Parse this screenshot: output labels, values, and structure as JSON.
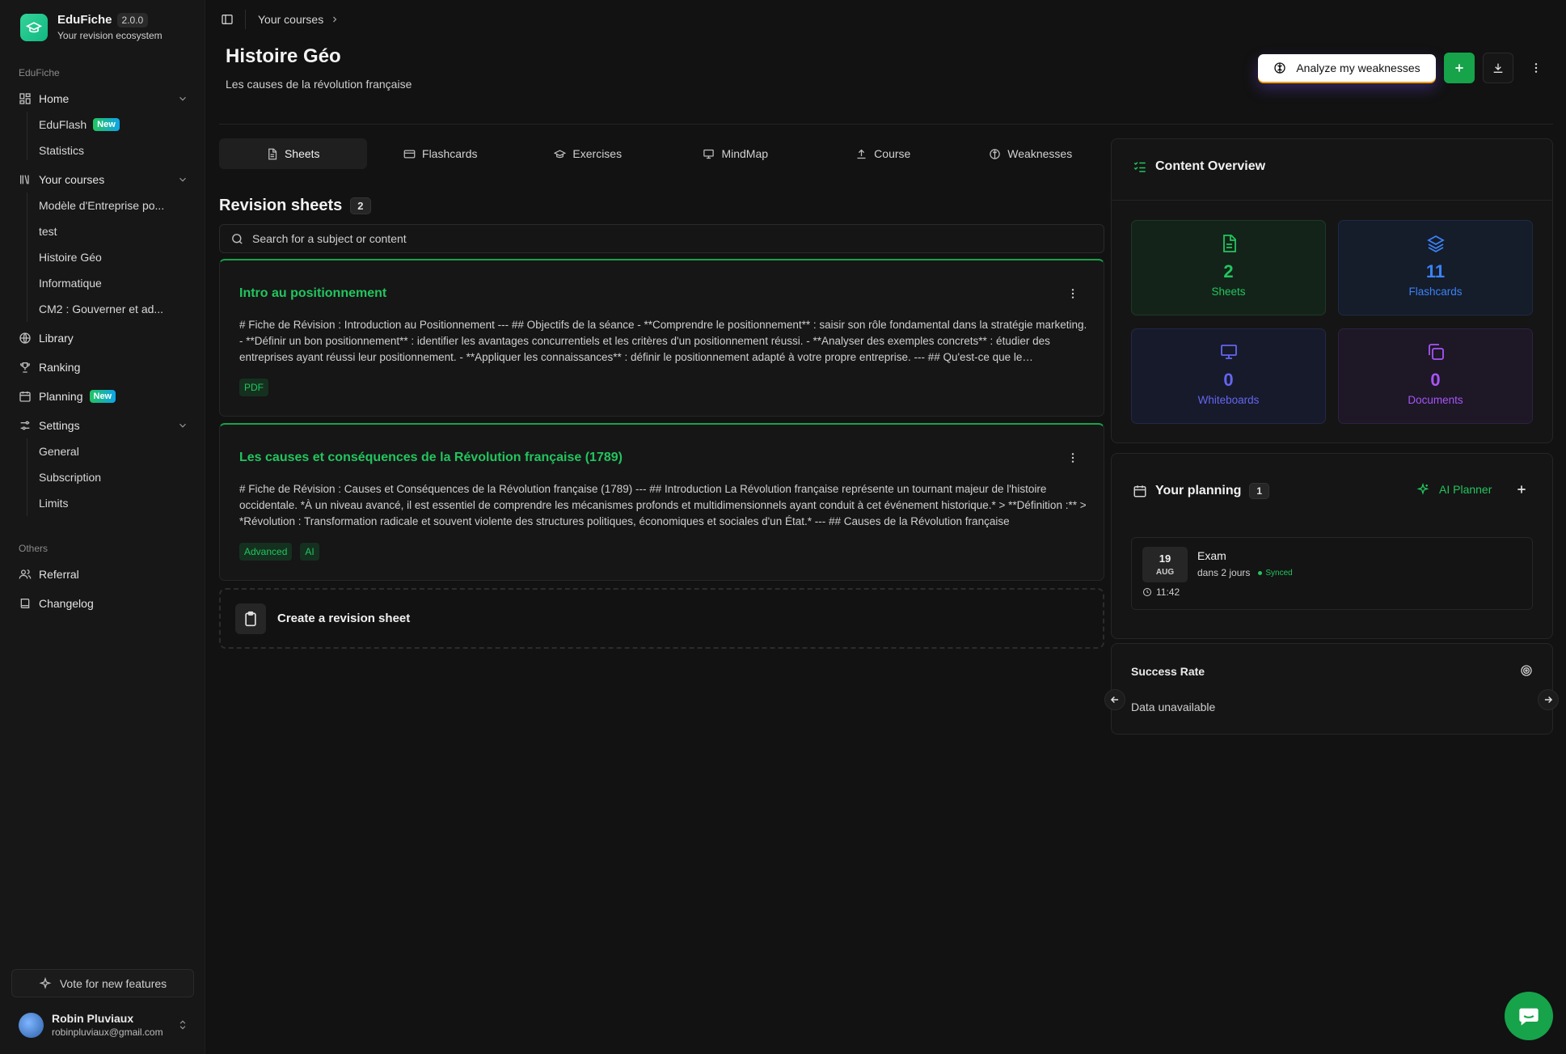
{
  "app": {
    "name": "EduFiche",
    "version": "2.0.0",
    "tagline": "Your revision ecosystem"
  },
  "sidebar": {
    "section_main": "EduFiche",
    "home": "Home",
    "eduflash": "EduFlash",
    "new_badge": "New",
    "statistics": "Statistics",
    "your_courses": "Your courses",
    "courses": [
      "Modèle d'Entreprise po...",
      "test",
      "Histoire Géo",
      "Informatique",
      "CM2 : Gouverner et ad..."
    ],
    "library": "Library",
    "ranking": "Ranking",
    "planning": "Planning",
    "settings": "Settings",
    "settings_items": [
      "General",
      "Subscription",
      "Limits"
    ],
    "section_others": "Others",
    "referral": "Referral",
    "changelog": "Changelog",
    "vote": "Vote for new features",
    "user": {
      "name": "Robin Pluviaux",
      "email": "robinpluviaux@gmail.com"
    }
  },
  "header": {
    "breadcrumb": "Your courses",
    "title": "Histoire Géo",
    "subtitle": "Les causes de la révolution française",
    "analyze_label": "Analyze my weaknesses"
  },
  "tabs": [
    "Sheets",
    "Flashcards",
    "Exercises",
    "MindMap",
    "Course",
    "Weaknesses"
  ],
  "sheets": {
    "title": "Revision sheets",
    "count": "2",
    "search_placeholder": "Search for a subject or content",
    "items": [
      {
        "title": "Intro au positionnement",
        "body": "# Fiche de Révision : Introduction au Positionnement --- ## Objectifs de la séance - **Comprendre le positionnement** : saisir son rôle fondamental dans la stratégie marketing. - **Définir un bon positionnement** : identifier les avantages concurrentiels et les critères d'un positionnement réussi. - **Analyser des exemples concrets** : étudier des entreprises ayant réussi leur positionnement. - **Appliquer les connaissances** : définir le positionnement adapté à votre propre entreprise. --- ## Qu'est-ce que le positionnement ?",
        "tags": [
          "PDF"
        ]
      },
      {
        "title": "Les causes et conséquences de la Révolution française (1789)",
        "body": "# Fiche de Révision : Causes et Conséquences de la Révolution française (1789) --- ## Introduction La Révolution française représente un tournant majeur de l'histoire occidentale. *À un niveau avancé, il est essentiel de comprendre les mécanismes profonds et multidimensionnels ayant conduit à cet événement historique.* > **Définition :** > *Révolution : Transformation radicale et souvent violente des structures politiques, économiques et sociales d'un État.* --- ## Causes de la Révolution française",
        "tags": [
          "Advanced",
          "AI"
        ]
      }
    ],
    "create_label": "Create a revision sheet"
  },
  "overview": {
    "title": "Content Overview",
    "stats": [
      {
        "value": "2",
        "label": "Sheets"
      },
      {
        "value": "11",
        "label": "Flashcards"
      },
      {
        "value": "0",
        "label": "Whiteboards"
      },
      {
        "value": "0",
        "label": "Documents"
      }
    ]
  },
  "planning": {
    "title": "Your planning",
    "count": "1",
    "ai_planner": "AI Planner",
    "event": {
      "day": "19",
      "month": "AUG",
      "title": "Exam",
      "when": "dans 2 jours",
      "status": "Synced",
      "time": "11:42"
    }
  },
  "success": {
    "title": "Success Rate",
    "value": "Data unavailable"
  },
  "colors": {
    "accent": "#16a34a",
    "accent_text": "#22c55e",
    "background": "#121212"
  }
}
